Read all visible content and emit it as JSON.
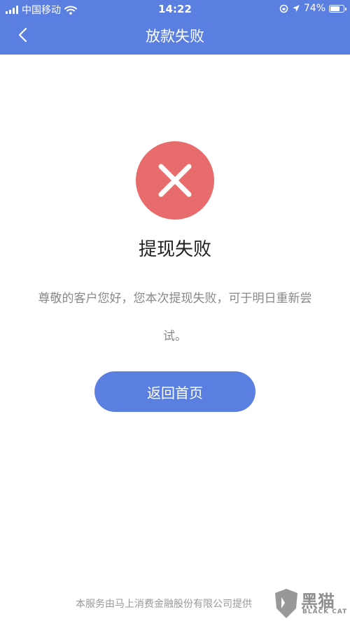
{
  "status_bar": {
    "carrier": "中国移动",
    "time": "14:22",
    "battery": "74%",
    "battery_level": 0.74
  },
  "nav": {
    "title": "放款失败",
    "back_icon": "chevron-left-icon"
  },
  "result": {
    "icon": "close-icon",
    "icon_color": "#e86c6c",
    "title": "提现失败",
    "message": "尊敬的客户您好，您本次提现失败，可于明日重新尝试。"
  },
  "actions": {
    "home_label": "返回首页"
  },
  "footer": {
    "text": "本服务由马上消费金融股份有限公司提供"
  },
  "watermark": {
    "text": "黑猫",
    "sub": "BLACK CAT"
  },
  "colors": {
    "brand": "#5b7fe0",
    "error": "#e86c6c"
  }
}
